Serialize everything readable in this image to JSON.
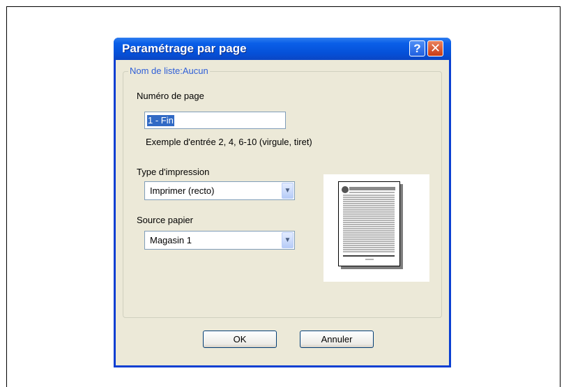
{
  "dialog": {
    "title": "Paramétrage par page",
    "help_label": "?",
    "close_label": "✕"
  },
  "group": {
    "legend": "Nom de liste:Aucun"
  },
  "page_number": {
    "label": "Numéro de page",
    "value": "1 - Fin",
    "example": "Exemple d'entrée 2, 4, 6-10 (virgule, tiret)"
  },
  "print_type": {
    "label": "Type d'impression",
    "selected": "Imprimer (recto)"
  },
  "paper_source": {
    "label": "Source papier",
    "selected": "Magasin 1"
  },
  "buttons": {
    "ok": "OK",
    "cancel": "Annuler"
  },
  "icons": {
    "dropdown": "chevron-down-icon",
    "preview": "page-preview-icon"
  },
  "colors": {
    "title_bar": "#0550d8",
    "dialog_bg": "#ece9d8",
    "legend_text": "#2f5fd7",
    "selection": "#316ac5"
  }
}
